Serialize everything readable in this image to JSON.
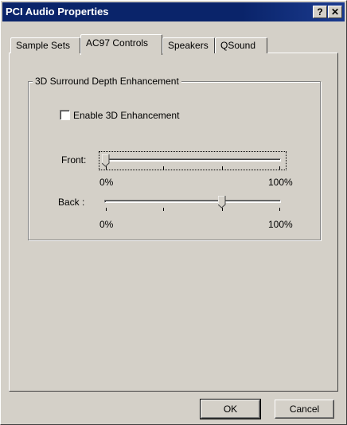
{
  "window": {
    "title": "PCI Audio Properties"
  },
  "titlebar_buttons": {
    "help": "?",
    "close": "✕"
  },
  "tabs": [
    {
      "label": "Sample Sets"
    },
    {
      "label": "AC97 Controls"
    },
    {
      "label": "Speakers"
    },
    {
      "label": "QSound"
    }
  ],
  "group": {
    "title": "3D Surround Depth Enhancement",
    "checkbox_label": "Enable 3D Enhancement",
    "checkbox_checked": false
  },
  "sliders": [
    {
      "label": "Front:",
      "min_label": "0%",
      "max_label": "100%",
      "value": 0
    },
    {
      "label": "Back :",
      "min_label": "0%",
      "max_label": "100%",
      "value": 67
    }
  ],
  "buttons": {
    "ok": "OK",
    "cancel": "Cancel"
  }
}
